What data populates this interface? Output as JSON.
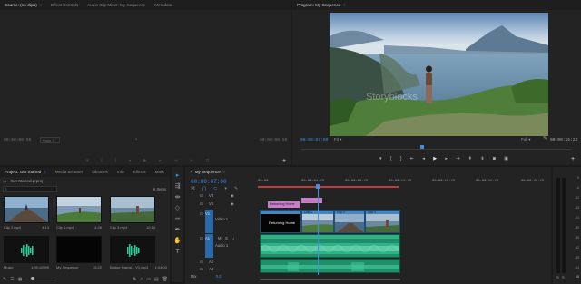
{
  "source_panel": {
    "tabs": [
      {
        "label": "Source: (no clips)",
        "active": true
      },
      {
        "label": "Effect Controls",
        "active": false
      },
      {
        "label": "Audio Clip Mixer: My Sequence",
        "active": false
      },
      {
        "label": "Metadata",
        "active": false
      }
    ],
    "timecode_left": "00;00;00;00",
    "timecode_right": "00;00;00;00",
    "page_label": "Page 1"
  },
  "program_panel": {
    "tab_label": "Program: My Sequence",
    "timecode": "00:00:07:00",
    "fit": "Fit",
    "quality": "Full",
    "duration": "00:00:15:22",
    "watermark": "Storyblocks"
  },
  "project_panel": {
    "tabs": [
      {
        "label": "Project: Get Started",
        "active": true
      },
      {
        "label": "Media Browser",
        "active": false
      },
      {
        "label": "Libraries",
        "active": false
      },
      {
        "label": "Info",
        "active": false
      },
      {
        "label": "Effects",
        "active": false
      },
      {
        "label": "Mark",
        "active": false
      }
    ],
    "file_name": "Get Started.prproj",
    "item_count": "6 Items",
    "items": [
      {
        "label": "Clip 2.mp4",
        "duration": "4:13"
      },
      {
        "label": "Clip 1.mp4",
        "duration": "4:26"
      },
      {
        "label": "Clip 3.mp4",
        "duration": "12:14"
      },
      {
        "label": "Music",
        "duration": "1:05:10999"
      },
      {
        "label": "My Sequence",
        "duration": "15:22"
      },
      {
        "label": "Bridge Narrat... V1.mp3",
        "duration": "1:04:00"
      }
    ]
  },
  "timeline": {
    "tab_label": "My Sequence",
    "timecode": "00:00:07:00",
    "ruler": [
      "00:00",
      "00:00:04:23",
      "00:00:09:23",
      "00:00:14:23",
      "00:00:19:23",
      "00:00:24:23",
      "00:00:29:23"
    ],
    "playhead_fraction": 0.448,
    "tracks": {
      "v3": "V3",
      "v2": "V2",
      "v1": "V1",
      "v1_label": "Video 1",
      "a1": "A1",
      "a1_label": "Audio 1",
      "a2": "A2",
      "a3": "A3",
      "mix": "Mix",
      "mix_value": "0.0"
    },
    "title_clip_label": "Returning Home",
    "title_clip_text": "Returning Home",
    "video_clips": [
      "Clip 1",
      "Clip 2",
      "Clip 3"
    ]
  },
  "audio_meter": {
    "scale": [
      "0",
      "-6",
      "-12",
      "-18",
      "-24",
      "-30",
      "-36",
      "-42",
      "-48",
      "-54",
      "dB"
    ],
    "labels": [
      "S",
      "S"
    ]
  },
  "icons": [
    "wrench-icon",
    "add-icon",
    "play-icon",
    "step-back-icon",
    "step-forward-icon",
    "camera-icon",
    "selection-tool-icon",
    "razor-tool-icon",
    "hand-tool-icon",
    "text-tool-icon",
    "search-icon",
    "folder-icon",
    "trash-icon"
  ]
}
